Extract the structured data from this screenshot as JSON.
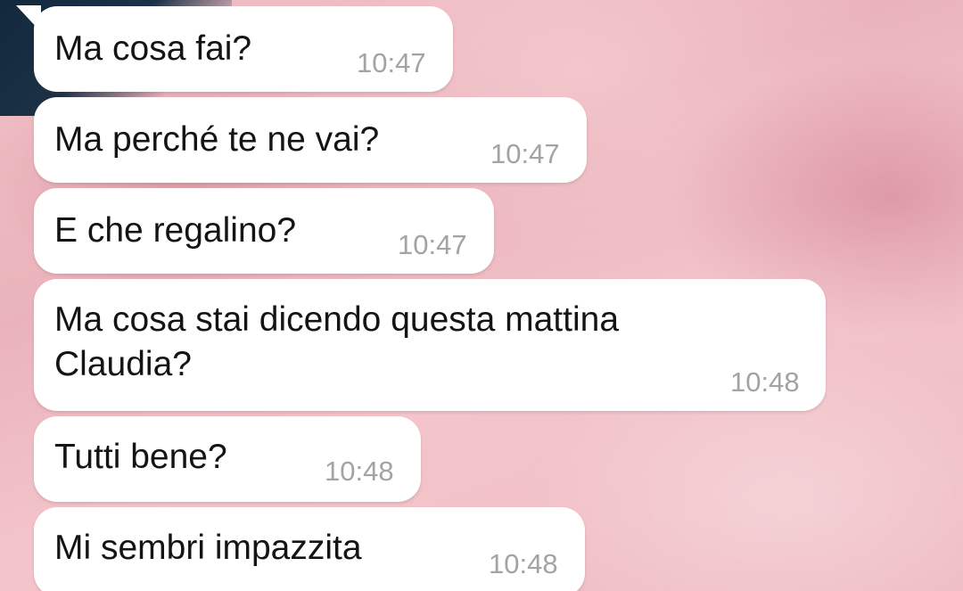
{
  "chat": {
    "messages": [
      {
        "text": "Ma cosa fai?",
        "time": "10:47"
      },
      {
        "text": "Ma perché te ne vai?",
        "time": "10:47"
      },
      {
        "text": "E che regalino?",
        "time": "10:47"
      },
      {
        "text": "Ma cosa stai dicendo questa mattina\nClaudia?",
        "time": "10:48"
      },
      {
        "text": "Tutti bene?",
        "time": "10:48"
      },
      {
        "text": "Mi sembri impazzita",
        "time": "10:48"
      }
    ]
  },
  "colors": {
    "bubble": "#ffffff",
    "text": "#141414",
    "time": "#a3a3a3",
    "wallpaper": "#eeb8c0"
  }
}
